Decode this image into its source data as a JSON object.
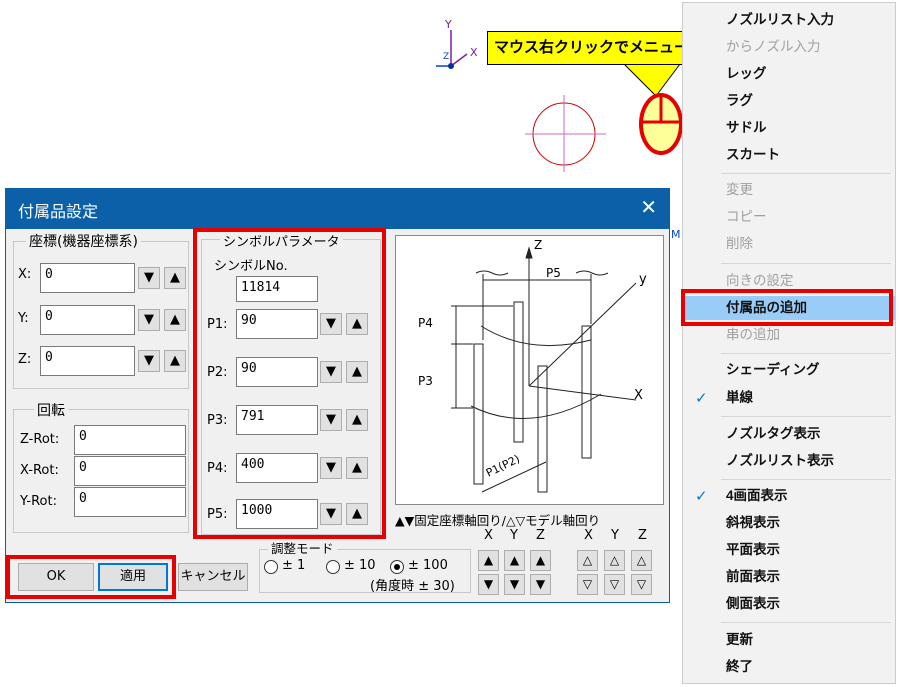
{
  "canvas": {
    "axis_y": "Y",
    "axis_x": "X",
    "axis_z": "Z",
    "stray_m": "M"
  },
  "callout": {
    "text": "マウス右クリックでメニューを表示"
  },
  "context_menu": {
    "items": [
      {
        "label": "ノズルリスト入力",
        "state": "enabled"
      },
      {
        "label": "からノズル入力",
        "state": "disabled"
      },
      {
        "label": "レッグ",
        "state": "enabled"
      },
      {
        "label": "ラグ",
        "state": "enabled"
      },
      {
        "label": "サドル",
        "state": "enabled"
      },
      {
        "label": "スカート",
        "state": "enabled"
      },
      {
        "label": "変更",
        "state": "disabled"
      },
      {
        "label": "コピー",
        "state": "disabled"
      },
      {
        "label": "削除",
        "state": "disabled"
      },
      {
        "label": "向きの設定",
        "state": "disabled"
      },
      {
        "label": "付属品の追加",
        "state": "highlighted"
      },
      {
        "label": "串の追加",
        "state": "disabled"
      },
      {
        "label": "シェーディング",
        "state": "enabled"
      },
      {
        "label": "単線",
        "state": "checked"
      },
      {
        "label": "ノズルタグ表示",
        "state": "enabled"
      },
      {
        "label": "ノズルリスト表示",
        "state": "enabled"
      },
      {
        "label": "4画面表示",
        "state": "checked"
      },
      {
        "label": "斜視表示",
        "state": "enabled"
      },
      {
        "label": "平面表示",
        "state": "enabled"
      },
      {
        "label": "前面表示",
        "state": "enabled"
      },
      {
        "label": "側面表示",
        "state": "enabled"
      },
      {
        "label": "更新",
        "state": "enabled"
      },
      {
        "label": "終了",
        "state": "enabled"
      }
    ],
    "check_mark": "✓"
  },
  "dialog": {
    "title": "付属品設定",
    "close_glyph": "✕",
    "coord_group": {
      "title": "座標(機器座標系)",
      "fields": [
        {
          "label": "X:",
          "value": "0"
        },
        {
          "label": "Y:",
          "value": "0"
        },
        {
          "label": "Z:",
          "value": "0"
        }
      ]
    },
    "rotation_group": {
      "title": "回転",
      "fields": [
        {
          "label": "Z-Rot:",
          "value": "0"
        },
        {
          "label": "X-Rot:",
          "value": "0"
        },
        {
          "label": "Y-Rot:",
          "value": "0"
        }
      ]
    },
    "symbol_group": {
      "title": "シンボルパラメータ",
      "symbol_no_label": "シンボルNo.",
      "symbol_no": "11814",
      "params": [
        {
          "label": "P1:",
          "value": "90"
        },
        {
          "label": "P2:",
          "value": "90"
        },
        {
          "label": "P3:",
          "value": "791"
        },
        {
          "label": "P4:",
          "value": "400"
        },
        {
          "label": "P5:",
          "value": "1000"
        }
      ]
    },
    "diagram_labels": {
      "z": "Z",
      "y": "y",
      "x": "X",
      "p5": "P5",
      "p4": "P4",
      "p3": "P3",
      "p1p2": "P1(P2)"
    },
    "rotate_caption": "▲▼固定座標軸回り/△▽モデル軸回り",
    "axis_headers_fixed": [
      "X",
      "Y",
      "Z"
    ],
    "axis_headers_model": [
      "X",
      "Y",
      "Z"
    ],
    "adjust_mode": {
      "title": "調整モード",
      "options": [
        {
          "label": "± 1",
          "selected": false
        },
        {
          "label": "± 10",
          "selected": false
        },
        {
          "label": "± 100",
          "selected": true
        }
      ],
      "angle_note": "(角度時 ± 30)"
    },
    "buttons": {
      "ok": "OK",
      "apply": "適用",
      "cancel": "キャンセル"
    },
    "glyphs": {
      "up": "▲",
      "down": "▼",
      "up_outline": "△",
      "down_outline": "▽"
    }
  }
}
